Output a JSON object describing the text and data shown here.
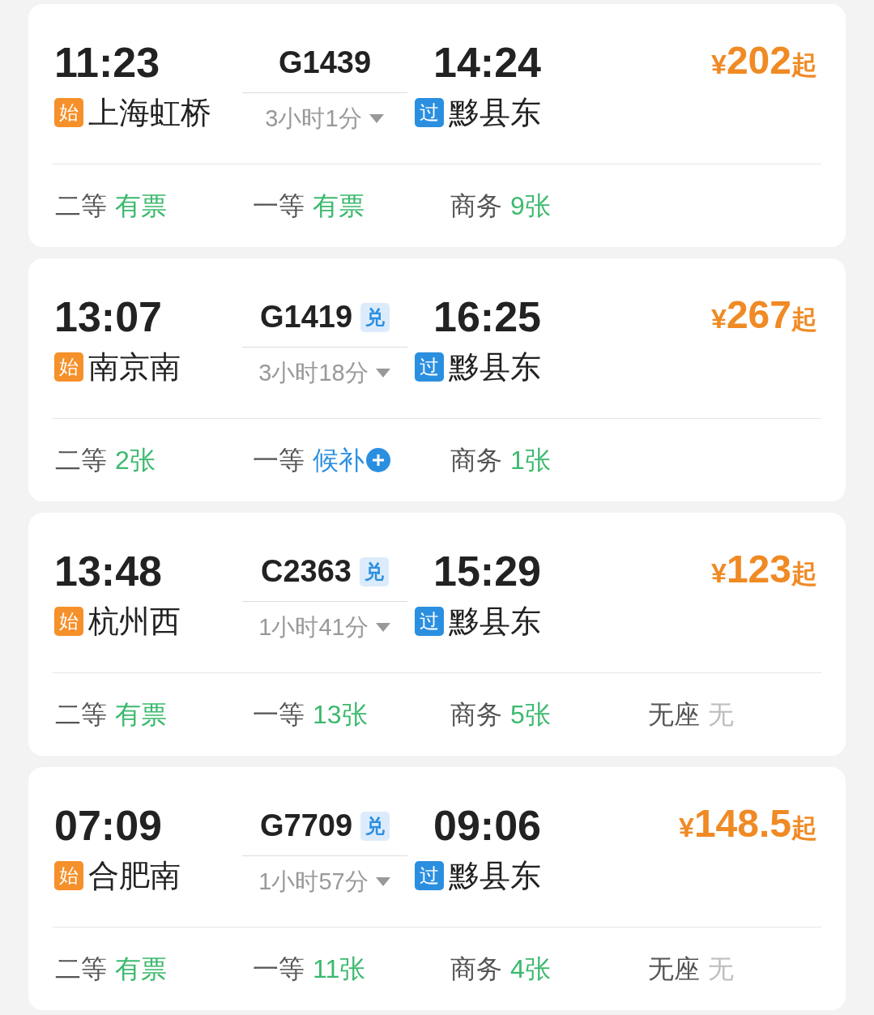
{
  "trains": [
    {
      "depart_time": "11:23",
      "depart_badge": "始",
      "depart_station": "上海虹桥",
      "train_no": "G1439",
      "duration": "3小时1分",
      "arrive_time": "14:24",
      "arrive_badge": "过",
      "arrive_station": "黟县东",
      "currency": "¥",
      "price": "202",
      "price_suffix": "起",
      "seats": [
        {
          "class": "二等",
          "status": "有票",
          "kind": "available"
        },
        {
          "class": "一等",
          "status": "有票",
          "kind": "available"
        },
        {
          "class": "商务",
          "status": "9张",
          "kind": "available"
        }
      ]
    },
    {
      "depart_time": "13:07",
      "depart_badge": "始",
      "depart_station": "南京南",
      "train_no": "G1419",
      "exchange_badge": "兑",
      "duration": "3小时18分",
      "arrive_time": "16:25",
      "arrive_badge": "过",
      "arrive_station": "黟县东",
      "currency": "¥",
      "price": "267",
      "price_suffix": "起",
      "seats": [
        {
          "class": "二等",
          "status": "2张",
          "kind": "available"
        },
        {
          "class": "一等",
          "status": "候补",
          "kind": "waitlist"
        },
        {
          "class": "商务",
          "status": "1张",
          "kind": "available"
        }
      ]
    },
    {
      "depart_time": "13:48",
      "depart_badge": "始",
      "depart_station": "杭州西",
      "train_no": "C2363",
      "exchange_badge": "兑",
      "duration": "1小时41分",
      "arrive_time": "15:29",
      "arrive_badge": "过",
      "arrive_station": "黟县东",
      "currency": "¥",
      "price": "123",
      "price_suffix": "起",
      "seats": [
        {
          "class": "二等",
          "status": "有票",
          "kind": "available"
        },
        {
          "class": "一等",
          "status": "13张",
          "kind": "available"
        },
        {
          "class": "商务",
          "status": "5张",
          "kind": "available"
        },
        {
          "class": "无座",
          "status": "无",
          "kind": "none"
        }
      ]
    },
    {
      "depart_time": "07:09",
      "depart_badge": "始",
      "depart_station": "合肥南",
      "train_no": "G7709",
      "exchange_badge": "兑",
      "duration": "1小时57分",
      "arrive_time": "09:06",
      "arrive_badge": "过",
      "arrive_station": "黟县东",
      "currency": "¥",
      "price": "148.5",
      "price_suffix": "起",
      "seats": [
        {
          "class": "二等",
          "status": "有票",
          "kind": "available"
        },
        {
          "class": "一等",
          "status": "11张",
          "kind": "available"
        },
        {
          "class": "商务",
          "status": "4张",
          "kind": "available"
        },
        {
          "class": "无座",
          "status": "无",
          "kind": "none"
        }
      ]
    }
  ]
}
